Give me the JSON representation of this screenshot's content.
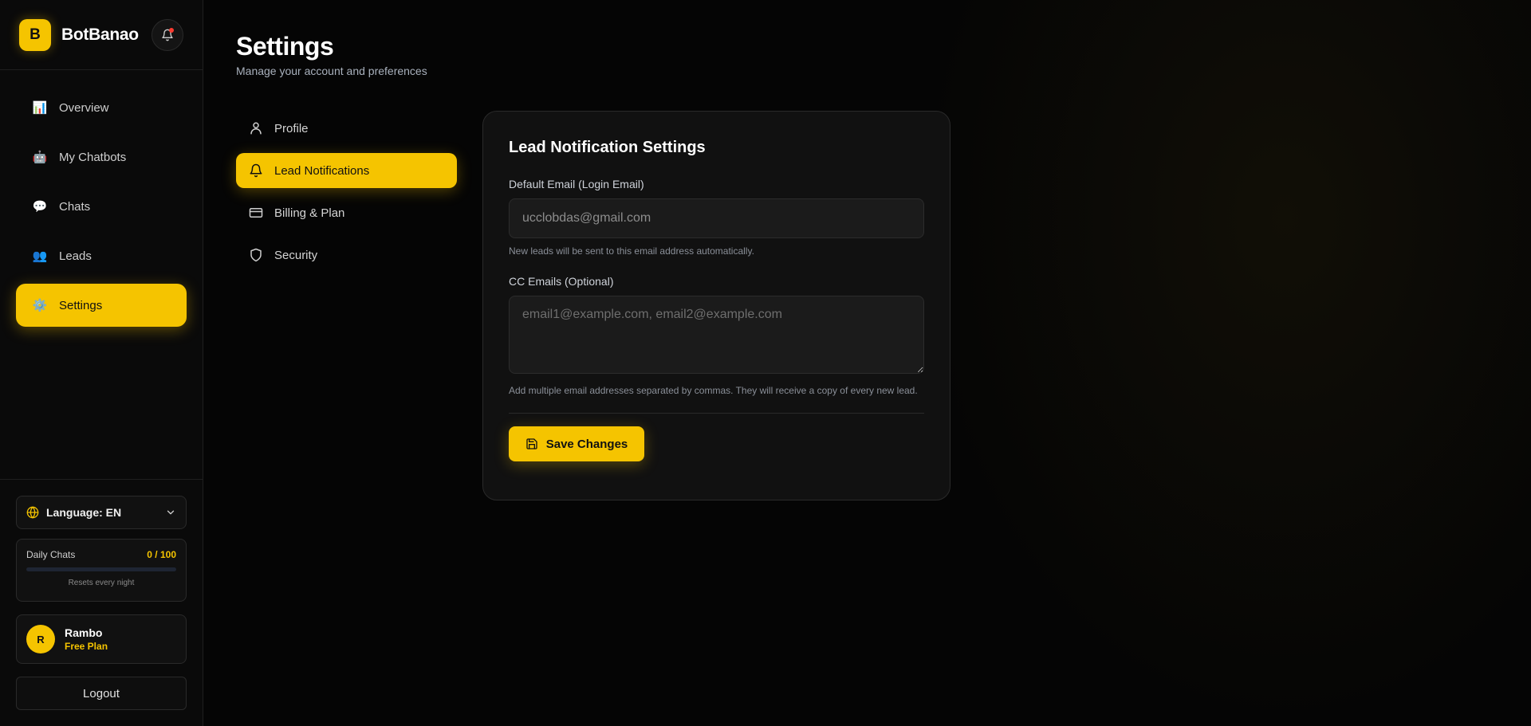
{
  "brand": {
    "logo_letter": "B",
    "name": "BotBanao"
  },
  "notifications": {
    "icon": "bell-icon",
    "has_unread": true
  },
  "sidebar": {
    "items": [
      {
        "label": "Overview",
        "icon": "📊",
        "active": false
      },
      {
        "label": "My Chatbots",
        "icon": "🤖",
        "active": false
      },
      {
        "label": "Chats",
        "icon": "💬",
        "active": false
      },
      {
        "label": "Leads",
        "icon": "👥",
        "active": false
      },
      {
        "label": "Settings",
        "icon": "⚙️",
        "active": true
      }
    ]
  },
  "language": {
    "label": "Language: EN"
  },
  "usage": {
    "title": "Daily Chats",
    "value": "0 / 100",
    "progress": 0,
    "note": "Resets every night"
  },
  "user": {
    "initial": "R",
    "name": "Rambo",
    "plan": "Free Plan"
  },
  "logout": {
    "label": "Logout"
  },
  "page": {
    "title": "Settings",
    "subtitle": "Manage your account and preferences"
  },
  "settings_nav": [
    {
      "label": "Profile",
      "icon": "user-icon",
      "active": false
    },
    {
      "label": "Lead Notifications",
      "icon": "bell-icon",
      "active": true
    },
    {
      "label": "Billing & Plan",
      "icon": "credit-card-icon",
      "active": false
    },
    {
      "label": "Security",
      "icon": "shield-icon",
      "active": false
    }
  ],
  "form": {
    "title": "Lead Notification Settings",
    "default_email_label": "Default Email (Login Email)",
    "default_email_value": "ucclobdas@gmail.com",
    "default_email_hint": "New leads will be sent to this email address automatically.",
    "cc_label": "CC Emails (Optional)",
    "cc_placeholder": "email1@example.com, email2@example.com",
    "cc_hint": "Add multiple email addresses separated by commas. They will receive a copy of every new lead.",
    "save_label": "Save Changes"
  },
  "colors": {
    "accent": "#f5c400",
    "background": "#050505",
    "card": "#111111"
  }
}
